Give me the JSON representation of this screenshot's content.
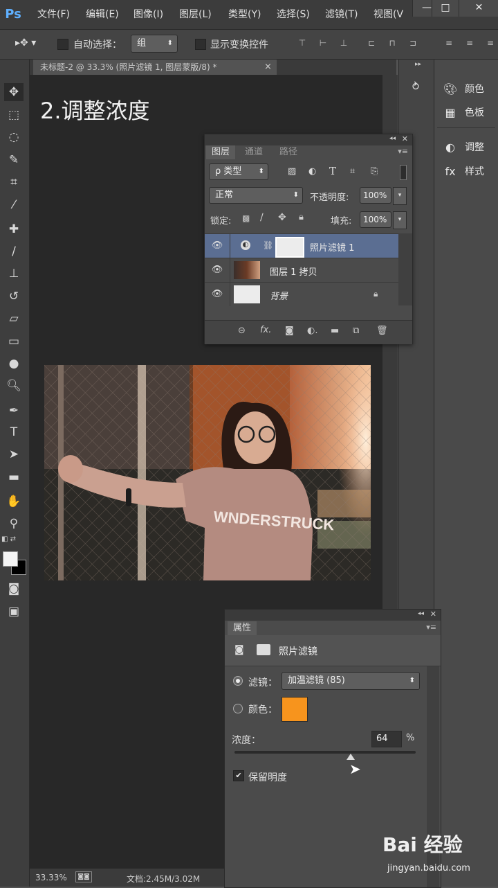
{
  "app": {
    "logo": "Ps"
  },
  "menu": [
    "文件(F)",
    "编辑(E)",
    "图像(I)",
    "图层(L)",
    "类型(Y)",
    "选择(S)",
    "滤镜(T)",
    "视图(V"
  ],
  "window_buttons": [
    "—",
    "□",
    "✕"
  ],
  "options_bar": {
    "auto_select_label": "自动选择：",
    "auto_select_value": "组",
    "show_transform_label": "显示变换控件"
  },
  "document": {
    "tab_title": "未标题-2 @ 33.3% (照片滤镜 1, 图层蒙版/8) *",
    "tab_close": "×",
    "step_title": "2.调整浓度",
    "zoom": "33.33%",
    "doc_size": "文档:2.45M/3.02M"
  },
  "dock": {
    "items": [
      {
        "label": "颜色",
        "icon": "palette-icon"
      },
      {
        "label": "色板",
        "icon": "swatches-icon"
      },
      {
        "label": "调整",
        "icon": "adjustments-icon"
      },
      {
        "label": "样式",
        "icon": "styles-icon"
      }
    ]
  },
  "layers_panel": {
    "tabs": [
      "图层",
      "通道",
      "路径"
    ],
    "filter_kind": "ρ 类型",
    "blend_mode": "正常",
    "opacity_label": "不透明度:",
    "opacity_value": "100%",
    "lock_label": "锁定:",
    "fill_label": "填充:",
    "fill_value": "100%",
    "layers": [
      {
        "name": "照片滤镜 1",
        "selected": true,
        "type": "adjustment"
      },
      {
        "name": "图层 1 拷贝",
        "selected": false,
        "type": "image"
      },
      {
        "name": "背景",
        "selected": false,
        "type": "background",
        "locked": true
      }
    ]
  },
  "properties_panel": {
    "tab": "属性",
    "title": "照片滤镜",
    "filter_label": "滤镜：",
    "filter_value": "加温滤镜 (85)",
    "filter_selected": true,
    "color_label": "颜色：",
    "color_value": "#f7941d",
    "density_label": "浓度：",
    "density_value": "64",
    "density_unit": "%",
    "density_fraction": 0.64,
    "preserve_label": "保留明度",
    "preserve_checked": true
  },
  "watermark": {
    "brand": "Bai 经验",
    "url": "jingyan.baidu.com"
  },
  "colors": {
    "accent_orange": "#f7941d",
    "selected_layer": "#5b6e92",
    "panel": "#4b4b4b",
    "canvas": "#282828"
  }
}
